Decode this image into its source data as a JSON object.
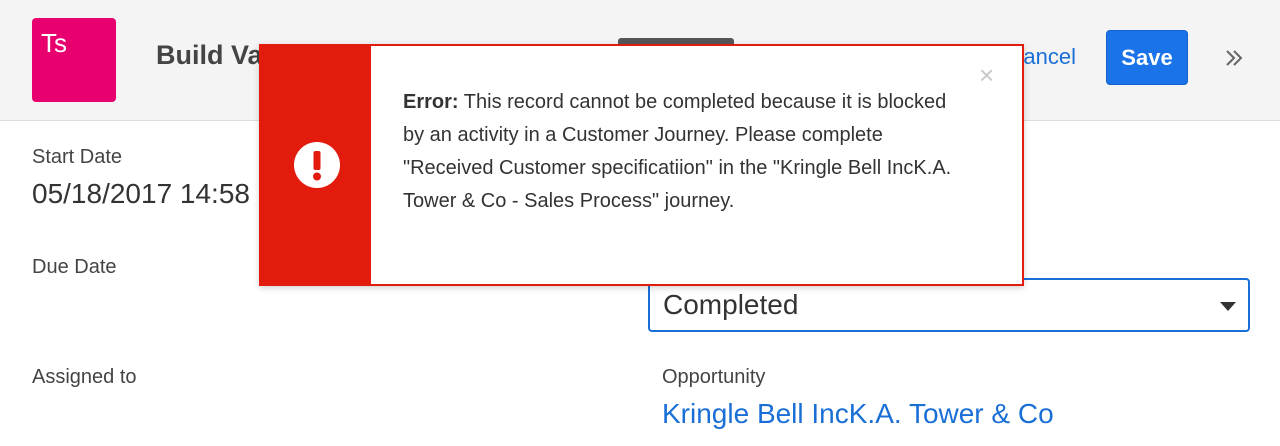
{
  "header": {
    "app_icon_text": "Ts",
    "app_icon_color": "#e8006f",
    "record_title": "Build Va",
    "cancel_label": "ancel",
    "save_label": "Save",
    "expand_icon": "double-chevron-right-icon"
  },
  "fields": {
    "start_date": {
      "label": "Start Date",
      "value": "05/18/2017 14:58"
    },
    "due_date": {
      "label": "Due Date"
    },
    "assigned_to": {
      "label": "Assigned to"
    },
    "status": {
      "selected": "Completed"
    },
    "opportunity": {
      "label": "Opportunity",
      "value": "Kringle Bell IncK.A. Tower & Co"
    }
  },
  "error_toast": {
    "error_label": "Error:",
    "message": "This record cannot be completed because it is blocked by an activity in a Customer Journey. Please complete \"Received Customer specificatiion\" in the \"Kringle Bell IncK.A. Tower & Co - Sales Process\" journey.",
    "close_glyph": "×",
    "icon": "exclamation-circle-icon",
    "accent_color": "#e21b0c"
  },
  "colors": {
    "link": "#1a6fd6",
    "primary_button": "#1a73e8"
  }
}
